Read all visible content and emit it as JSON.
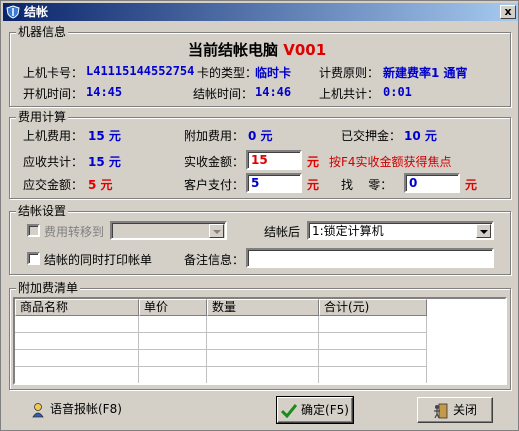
{
  "window": {
    "title": "结帐",
    "close_label": "x"
  },
  "machine_info": {
    "legend": "机器信息",
    "heading_prefix": "当前结帐电脑",
    "heading_code": "V001",
    "card_no_label": "上机卡号：",
    "card_no": "L41115144552754",
    "card_type_label": "卡的类型：",
    "card_type": "临时卡",
    "rule_label": "计费原则：",
    "rule": "新建费率1 通宵",
    "start_label": "开机时间：",
    "start": "14:45",
    "checkout_label": "结帐时间：",
    "checkout": "14:46",
    "total_time_label": "上机共计：",
    "total_time": "0:01"
  },
  "fees": {
    "legend": "费用计算",
    "usage_label": "上机费用：",
    "usage": "15 元",
    "extra_label": "附加费用：",
    "extra": "0 元",
    "deposit_label": "已交押金：",
    "deposit": "10 元",
    "receivable_label": "应收共计：",
    "receivable": "15 元",
    "actual_label": "实收金额：",
    "actual_value": "15",
    "unit": "元",
    "hint": "按F4实收金额获得焦点",
    "payable_label": "应交金额：",
    "payable": "5 元",
    "paid_label": "客户支付：",
    "paid_value": "5",
    "change_label": "找    零：",
    "change_value": "0"
  },
  "settings": {
    "legend": "结帐设置",
    "transfer_label": "费用转移到",
    "transfer_value": "",
    "after_label": "结帐后",
    "after_value": "1:锁定计算机",
    "print_label": "结帐的同时打印帐单",
    "remark_label": "备注信息：",
    "remark_value": ""
  },
  "extras": {
    "legend": "附加费清单",
    "columns": [
      "商品名称",
      "单价",
      "数量",
      "合计(元)"
    ]
  },
  "buttons": {
    "voice": "语音报帐(F8)",
    "confirm": "确定(F5)",
    "close": "关闭"
  }
}
